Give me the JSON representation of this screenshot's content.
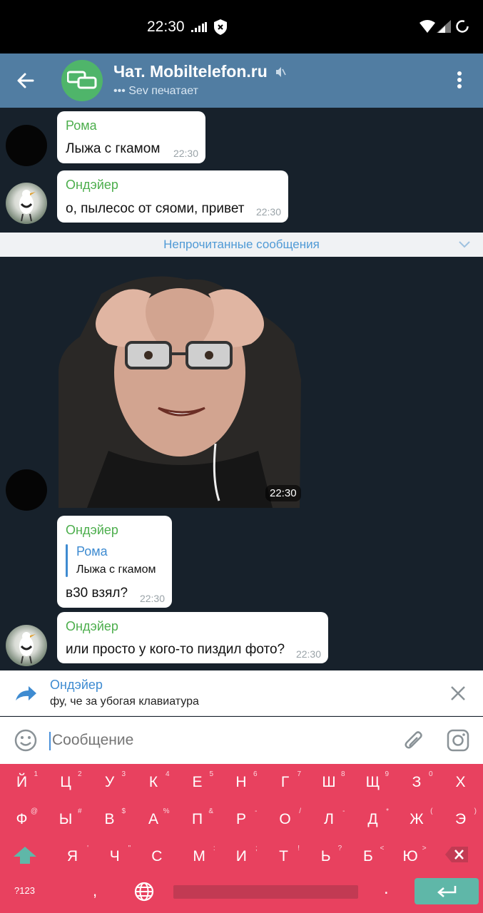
{
  "status_bar": {
    "time": "22:30"
  },
  "header": {
    "title": "Чат. Mobiltelefon.ru",
    "status": "••• Sev печатает",
    "accent_color": "#517da2"
  },
  "messages": [
    {
      "sender": "Рома",
      "text": "Лыжа с гкамом",
      "time": "22:30"
    },
    {
      "sender": "Ондэйер",
      "text": "о, пылесос от сяоми, привет",
      "time": "22:30"
    },
    {
      "sticker_time": "22:30"
    },
    {
      "sender": "Ондэйер",
      "reply_to": {
        "sender": "Рома",
        "text": "Лыжа с гкамом"
      },
      "text": "в30 взял?",
      "time": "22:30"
    },
    {
      "sender": "Ондэйер",
      "text": "или просто у кого-то пиздил фото?",
      "time": "22:30"
    }
  ],
  "unread_separator": "Непрочитанные сообщения",
  "reply_panel": {
    "sender": "Ондэйер",
    "text": "фу, че за убогая клавиатура"
  },
  "input": {
    "placeholder": "Сообщение"
  },
  "keyboard": {
    "row1": [
      {
        "key": "Й",
        "hint": "1"
      },
      {
        "key": "Ц",
        "hint": "2"
      },
      {
        "key": "У",
        "hint": "3"
      },
      {
        "key": "К",
        "hint": "4"
      },
      {
        "key": "Е",
        "hint": "5"
      },
      {
        "key": "Н",
        "hint": "6"
      },
      {
        "key": "Г",
        "hint": "7"
      },
      {
        "key": "Ш",
        "hint": "8"
      },
      {
        "key": "Щ",
        "hint": "9"
      },
      {
        "key": "З",
        "hint": "0"
      },
      {
        "key": "Х",
        "hint": ""
      }
    ],
    "row2": [
      {
        "key": "Ф",
        "hint": "@"
      },
      {
        "key": "Ы",
        "hint": "#"
      },
      {
        "key": "В",
        "hint": "$"
      },
      {
        "key": "А",
        "hint": "%"
      },
      {
        "key": "П",
        "hint": "&"
      },
      {
        "key": "Р",
        "hint": "-"
      },
      {
        "key": "О",
        "hint": "/"
      },
      {
        "key": "Л",
        "hint": "-"
      },
      {
        "key": "Д",
        "hint": "*"
      },
      {
        "key": "Ж",
        "hint": "("
      },
      {
        "key": "Э",
        "hint": ")"
      }
    ],
    "row3": [
      {
        "key": "Я",
        "hint": "'"
      },
      {
        "key": "Ч",
        "hint": "\""
      },
      {
        "key": "С",
        "hint": ""
      },
      {
        "key": "М",
        "hint": ":"
      },
      {
        "key": "И",
        "hint": ";"
      },
      {
        "key": "Т",
        "hint": "!"
      },
      {
        "key": "Ь",
        "hint": "?"
      },
      {
        "key": "Б",
        "hint": "<"
      },
      {
        "key": "Ю",
        "hint": ">"
      }
    ],
    "symbols_label": "?123",
    "comma": ",",
    "period": ".",
    "color": "#e8415f"
  }
}
